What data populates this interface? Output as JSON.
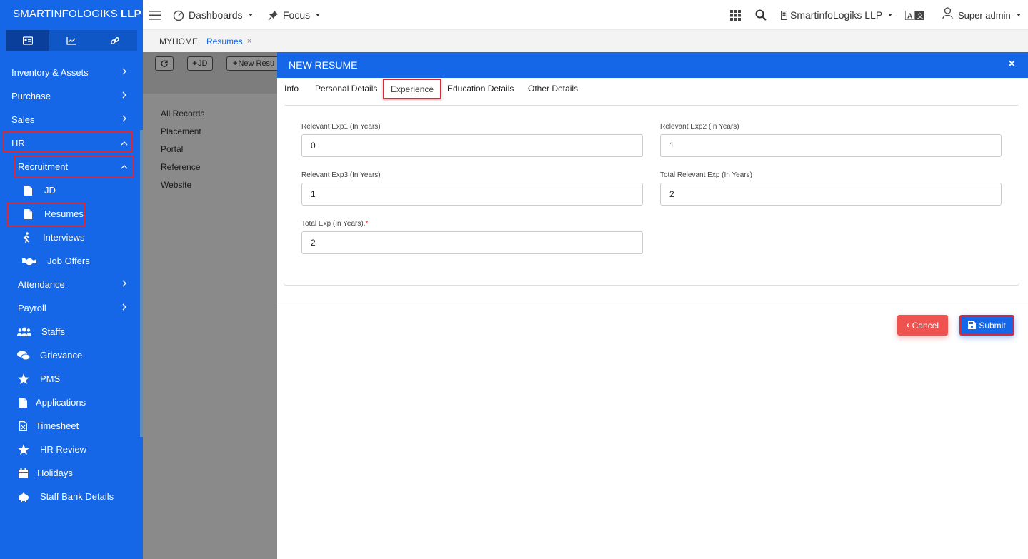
{
  "brand": {
    "name": "SMARTINFOLOGIKS",
    "suffix": "LLP"
  },
  "sidebar": {
    "items": [
      {
        "label": "Inventory & Assets"
      },
      {
        "label": "Purchase"
      },
      {
        "label": "Sales"
      },
      {
        "label": "HR"
      },
      {
        "label": "Recruitment"
      },
      {
        "label": "JD"
      },
      {
        "label": "Resumes"
      },
      {
        "label": "Interviews"
      },
      {
        "label": "Job Offers"
      },
      {
        "label": "Attendance"
      },
      {
        "label": "Payroll"
      },
      {
        "label": "Staffs"
      },
      {
        "label": "Grievance"
      },
      {
        "label": "PMS"
      },
      {
        "label": "Applications"
      },
      {
        "label": "Timesheet"
      },
      {
        "label": "HR Review"
      },
      {
        "label": "Holidays"
      },
      {
        "label": "Staff Bank Details"
      }
    ]
  },
  "topbar": {
    "dashboards": "Dashboards",
    "focus": "Focus",
    "company": "SmartinfoLogiks LLP",
    "user": "Super admin"
  },
  "breadcrumb": {
    "home": "MYHOME",
    "current": "Resumes",
    "close": "×"
  },
  "background": {
    "refresh_label": "",
    "jd_button": "JD",
    "new_button": "New Resu",
    "filters": [
      "All Records",
      "Placement",
      "Portal",
      "Reference",
      "Website"
    ]
  },
  "modal": {
    "title": "NEW RESUME",
    "close": "×",
    "tabs": [
      "Info",
      "Personal Details",
      "Experience",
      "Education Details",
      "Other Details"
    ],
    "active_tab": "Experience",
    "fields": {
      "exp1": {
        "label": "Relevant Exp1 (In Years)",
        "value": "0"
      },
      "exp2": {
        "label": "Relevant Exp2 (In Years)",
        "value": "1"
      },
      "exp3": {
        "label": "Relevant Exp3 (In Years)",
        "value": "1"
      },
      "total_relevant": {
        "label": "Total Relevant Exp (In Years)",
        "value": "2"
      },
      "total": {
        "label": "Total Exp (In Years).",
        "required_mark": "*",
        "value": "2"
      }
    },
    "cancel_label": "Cancel",
    "submit_label": "Submit"
  },
  "colors": {
    "primary": "#1567e8",
    "danger": "#ef5350",
    "highlight": "#d42a3a"
  }
}
